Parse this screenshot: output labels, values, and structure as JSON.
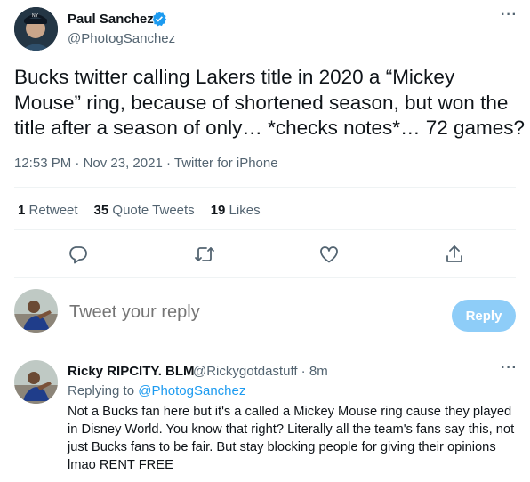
{
  "tweet": {
    "author_name": "Paul Sanchez",
    "author_handle": "@PhotogSanchez",
    "more_label": "···",
    "text": "Bucks twitter calling Lakers title in 2020 a “Mickey Mouse” ring, because of shortened season, but won the title after a season of only… *checks notes*… 72 games?",
    "time": "12:53 PM",
    "date": "Nov 23, 2021",
    "source": "Twitter for iPhone",
    "separator": " · "
  },
  "stats": {
    "retweets_count": "1",
    "retweets_label": "Retweet",
    "quotes_count": "35",
    "quotes_label": "Quote Tweets",
    "likes_count": "19",
    "likes_label": "Likes"
  },
  "actions": {
    "icons": [
      "reply-icon",
      "retweet-icon",
      "like-icon",
      "share-icon"
    ],
    "color": "#536471"
  },
  "composer": {
    "placeholder": "Tweet your reply",
    "button_label": "Reply",
    "button_color": "#8ecdf8"
  },
  "reply": {
    "author_name": "Ricky RIPCITY. BLM",
    "author_handle": "@Rickygotdastuff",
    "time_ago": "8m",
    "replying_prefix": "Replying to",
    "replying_to": "@PhotogSanchez",
    "more_label": "···",
    "text": "Not a Bucks fan here but it's a called a Mickey Mouse ring cause they played in Disney World. You know that right? Literally all the team's fans say this, not just Bucks fans to be fair. But stay blocking people for giving their opinions lmao RENT FREE"
  },
  "colors": {
    "link": "#1d9bf0",
    "verified": "#1d9bf0",
    "secondary_text": "#536471",
    "divider": "#eff3f4"
  }
}
